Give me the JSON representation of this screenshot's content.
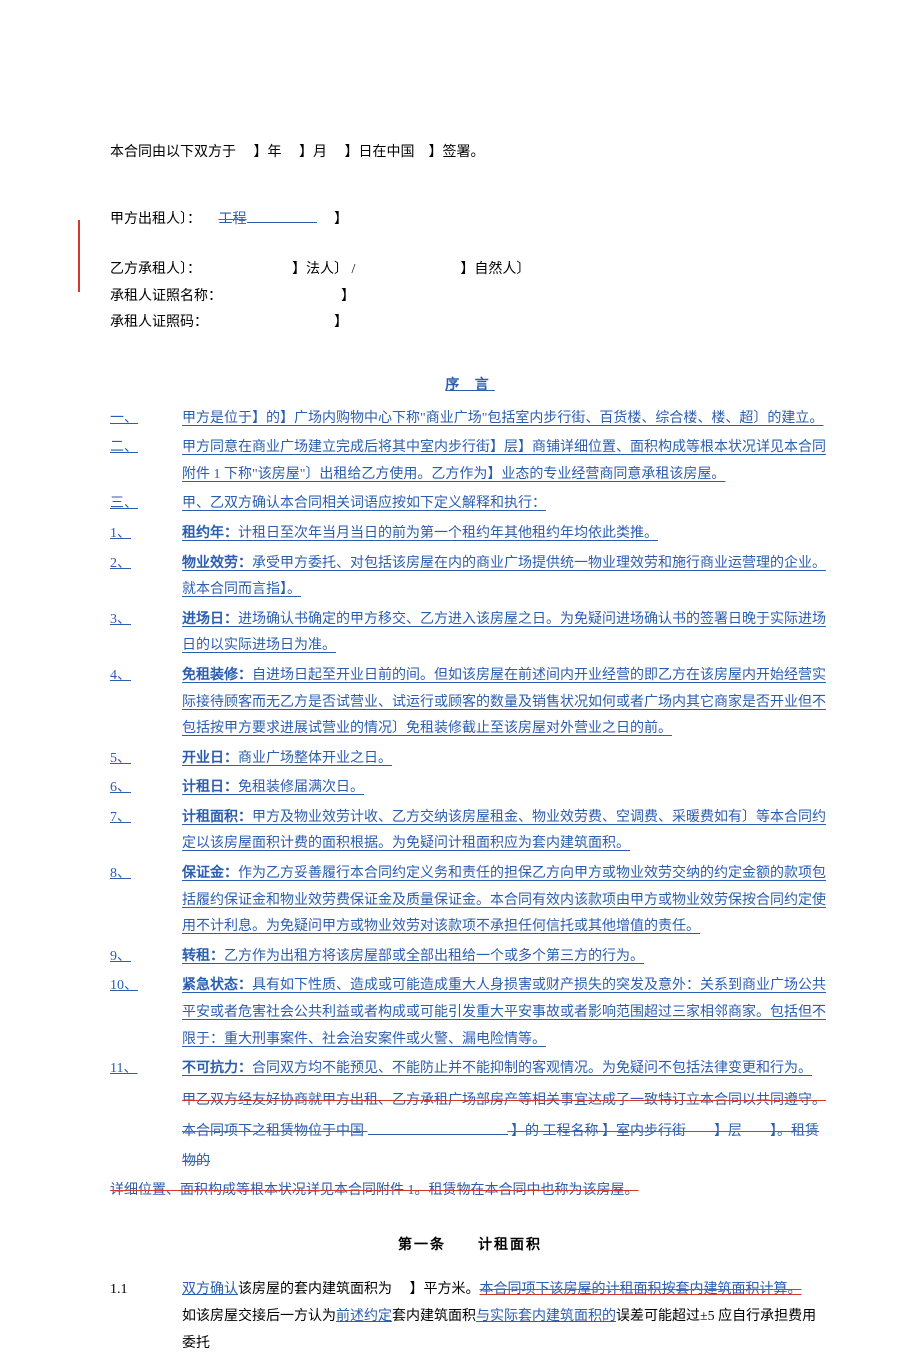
{
  "sig": {
    "prefix": "本合同由以下双方于",
    "y": "】年",
    "m": "】月",
    "d": "】日在中国",
    "suffix": "】签署。"
  },
  "parties": {
    "lessor_label": "甲方出租人〕：",
    "lessor_strike": "工程",
    "lessor_tail": "】",
    "lessee_label": "乙方承租人〕：",
    "lessee_legal": "】法人〕 /",
    "lessee_natural": "】自然人〕",
    "cert_name_label": "承租人证照名称：",
    "cert_name_tail": "】",
    "cert_no_label": "承租人证照码：",
    "cert_no_tail": "】"
  },
  "preface_title": "序 言",
  "pre": [
    {
      "n": "一、",
      "t": "甲方是位于】的】广场内购物中心下称\"商业广场\"包括室内步行街、百货楼、综合楼、楼、超〕的建立。"
    },
    {
      "n": "二、",
      "t": "甲方同意在商业广场建立完成后将其中室内步行街】层】商铺详细位置、面积构成等根本状况详见本合同附件 1 下称\"该房屋\"〕出租给乙方使用。乙方作为】业态的专业经营商同意承租该房屋。"
    },
    {
      "n": "三、",
      "t": "甲、乙双方确认本合同相关词语应按如下定义解释和执行："
    }
  ],
  "defs": [
    {
      "n": "1、",
      "term": "租约年：",
      "t": "计租日至次年当月当日的前为第一个租约年其他租约年均依此类推。"
    },
    {
      "n": "2、",
      "term": "物业效劳：",
      "t": "承受甲方委托、对包括该房屋在内的商业广场提供统一物业理效劳和施行商业运营理的企业。就本合同而言指】。"
    },
    {
      "n": "3、",
      "term": "进场日：",
      "t": "进场确认书确定的甲方移交、乙方进入该房屋之日。为免疑问进场确认书的签署日晚于实际进场日的以实际进场日为准。"
    },
    {
      "n": "4、",
      "term": "免租装修：",
      "t": "自进场日起至开业日前的间。但如该房屋在前述间内开业经营的即乙方在该房屋内开始经营实际接待顾客而无乙方是否试营业、试运行或顾客的数量及销售状况如何或者广场内其它商家是否开业但不包括按甲方要求进展试营业的情况〕免租装修截止至该房屋对外营业之日的前。"
    },
    {
      "n": "5、",
      "term": "开业日：",
      "t": "商业广场整体开业之日。",
      "strike_word": "之"
    },
    {
      "n": "6、",
      "term": "计租日：",
      "t": "免租装修届满次日。"
    },
    {
      "n": "7、",
      "term": "计租面积：",
      "t": "甲方及物业效劳计收、乙方交纳该房屋租金、物业效劳费、空调费、采暖费如有〕等本合同约定以该房屋面积计费的面积根据。为免疑问计租面积应为套内建筑面积。"
    },
    {
      "n": "8、",
      "term": "保证金：",
      "t": "作为乙方妥善履行本合同约定义务和责任的担保乙方向甲方或物业效劳交纳的约定金额的款项包括履约保证金和物业效劳费保证金及质量保证金。本合同有效内该款项由甲方或物业效劳保按合同约定使用不计利息。为免疑问甲方或物业效劳对该款项不承担任何信托或其他增值的责任。"
    },
    {
      "n": "9、",
      "term": "转租：",
      "t": "乙方作为出租方将该房屋部或全部出租给一个或多个第三方的行为。"
    },
    {
      "n": "10、",
      "term": "紧急状态：",
      "t": "具有如下性质、造成或可能造成重大人身损害或财产损失的突发及意外：关系到商业广场公共平安或者危害社会公共利益或者构成或可能引发重大平安事故或者影响范围超过三家相邻商家。包括但不限于：重大刑事案件、社会治安案件或火警、漏电险情等。"
    },
    {
      "n": "11、",
      "term": "不可抗力：",
      "t": "合同双方均不能预见、不能防止并不能抑制的客观情况。为免疑问不包括法律变更和行为。"
    }
  ],
  "strike_para1": "甲乙双方经友好协商就甲方出租、乙方承租广场部房产等相关事宜达成了一致特订立本合同以共同遵守。",
  "strike_para2_a": "本合同项下之租赁物位于中国",
  "strike_para2_b": "】的 工程名称 】室内步行街",
  "strike_para2_c": "】层",
  "strike_para2_d": "】。租赁物的",
  "strike_tail": "详细位置、面积构成等根本状况详见本合同附件 1。租赁物在本合同中也称为该房屋。",
  "article1": "第一条　　计租面积",
  "clause": {
    "num": "1.1",
    "ins1": "双方确认",
    "t1": "该房屋的套内建筑面积为",
    "t2": "】平方米。",
    "strike1": "本合同项下该房屋的计租面积按套内建筑面积计算。",
    "t3": "如该房屋交接后一方认为",
    "ins2": "前述约定",
    "t4": "套内建筑面积",
    "ins3": "与实际套内建筑面积的",
    "t5": "误差可能超过±5 应自行承担费用委托"
  }
}
